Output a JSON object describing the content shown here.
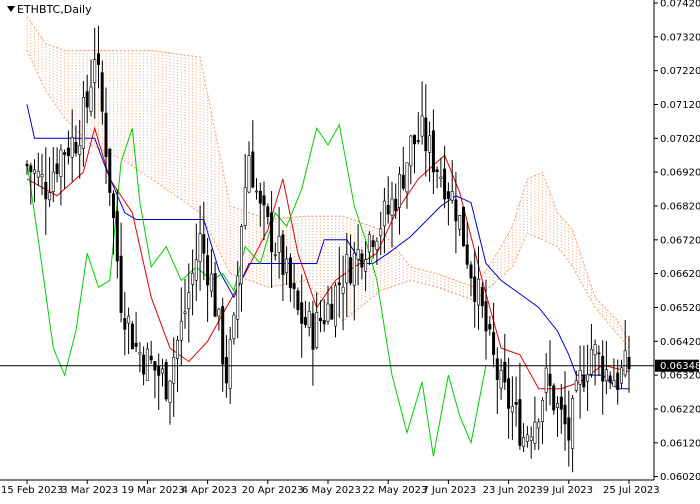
{
  "chart_data": {
    "type": "candlestick",
    "symbol": "ETHBTC",
    "timeframe": "Daily",
    "symbol_label": "ETHBTC,Daily",
    "current_price": 0.06348,
    "current_price_label": "0.06348",
    "ylim": [
      0.0601,
      0.0742
    ],
    "y_ticks": [
      0.0742,
      0.0732,
      0.0722,
      0.0712,
      0.0702,
      0.0692,
      0.0682,
      0.0672,
      0.0662,
      0.0652,
      0.0642,
      0.0632,
      0.0622,
      0.0612,
      0.0602
    ],
    "y_tick_labels": [
      "0.07420",
      "0.07320",
      "0.07220",
      "0.07120",
      "0.07020",
      "0.06920",
      "0.06820",
      "0.06720",
      "0.06620",
      "0.06520",
      "0.06420",
      "0.06320",
      "0.06220",
      "0.06120",
      "0.06020"
    ],
    "x_labels": [
      {
        "date": "2023-02-15",
        "label": "15 Feb 2023"
      },
      {
        "date": "2023-03-03",
        "label": "3 Mar 2023"
      },
      {
        "date": "2023-03-19",
        "label": "19 Mar 2023"
      },
      {
        "date": "2023-04-04",
        "label": "4 Apr 2023"
      },
      {
        "date": "2023-04-20",
        "label": "20 Apr 2023"
      },
      {
        "date": "2023-05-06",
        "label": "6 May 2023"
      },
      {
        "date": "2023-05-22",
        "label": "22 May 2023"
      },
      {
        "date": "2023-06-07",
        "label": "7 Jun 2023"
      },
      {
        "date": "2023-06-23",
        "label": "23 Jun 2023"
      },
      {
        "date": "2023-07-09",
        "label": "9 Jul 2023"
      },
      {
        "date": "2023-07-25",
        "label": "25 Jul 2023"
      }
    ],
    "date_range": [
      "2023-02-15",
      "2023-07-25"
    ],
    "close_anchors": [
      [
        "2023-02-15",
        0.0694
      ],
      [
        "2023-02-20",
        0.0688
      ],
      [
        "2023-02-24",
        0.0698
      ],
      [
        "2023-02-28",
        0.0702
      ],
      [
        "2023-03-03",
        0.0712
      ],
      [
        "2023-03-05",
        0.0728
      ],
      [
        "2023-03-08",
        0.07
      ],
      [
        "2023-03-12",
        0.0655
      ],
      [
        "2023-03-16",
        0.064
      ],
      [
        "2023-03-20",
        0.0635
      ],
      [
        "2023-03-24",
        0.063
      ],
      [
        "2023-03-28",
        0.0646
      ],
      [
        "2023-04-02",
        0.0672
      ],
      [
        "2023-04-05",
        0.066
      ],
      [
        "2023-04-09",
        0.0632
      ],
      [
        "2023-04-11",
        0.0645
      ],
      [
        "2023-04-13",
        0.0678
      ],
      [
        "2023-04-15",
        0.0698
      ],
      [
        "2023-04-18",
        0.068
      ],
      [
        "2023-04-23",
        0.0668
      ],
      [
        "2023-04-28",
        0.065
      ],
      [
        "2023-05-02",
        0.0645
      ],
      [
        "2023-05-06",
        0.0652
      ],
      [
        "2023-05-10",
        0.0662
      ],
      [
        "2023-05-14",
        0.0668
      ],
      [
        "2023-05-18",
        0.0675
      ],
      [
        "2023-05-22",
        0.068
      ],
      [
        "2023-05-25",
        0.0688
      ],
      [
        "2023-05-28",
        0.07
      ],
      [
        "2023-05-31",
        0.0703
      ],
      [
        "2023-06-03",
        0.0696
      ],
      [
        "2023-06-06",
        0.069
      ],
      [
        "2023-06-09",
        0.0682
      ],
      [
        "2023-06-12",
        0.0668
      ],
      [
        "2023-06-15",
        0.0655
      ],
      [
        "2023-06-18",
        0.064
      ],
      [
        "2023-06-21",
        0.0628
      ],
      [
        "2023-06-24",
        0.0622
      ],
      [
        "2023-06-27",
        0.0614
      ],
      [
        "2023-06-30",
        0.062
      ],
      [
        "2023-07-03",
        0.063
      ],
      [
        "2023-07-06",
        0.0622
      ],
      [
        "2023-07-09",
        0.0614
      ],
      [
        "2023-07-12",
        0.063
      ],
      [
        "2023-07-15",
        0.064
      ],
      [
        "2023-07-19",
        0.0633
      ],
      [
        "2023-07-22",
        0.0631
      ],
      [
        "2023-07-25",
        0.06348
      ]
    ],
    "series": [
      {
        "name": "tenkan",
        "color": "#e00000",
        "points": [
          [
            "2023-02-15",
            0.069
          ],
          [
            "2023-02-23",
            0.0685
          ],
          [
            "2023-03-02",
            0.0692
          ],
          [
            "2023-03-05",
            0.0705
          ],
          [
            "2023-03-09",
            0.069
          ],
          [
            "2023-03-15",
            0.068
          ],
          [
            "2023-03-20",
            0.0655
          ],
          [
            "2023-03-25",
            0.064
          ],
          [
            "2023-03-30",
            0.0636
          ],
          [
            "2023-04-04",
            0.0642
          ],
          [
            "2023-04-09",
            0.0652
          ],
          [
            "2023-04-14",
            0.0662
          ],
          [
            "2023-04-20",
            0.0675
          ],
          [
            "2023-04-24",
            0.069
          ],
          [
            "2023-04-28",
            0.0668
          ],
          [
            "2023-05-03",
            0.0652
          ],
          [
            "2023-05-08",
            0.066
          ],
          [
            "2023-05-13",
            0.0664
          ],
          [
            "2023-05-19",
            0.0668
          ],
          [
            "2023-05-24",
            0.068
          ],
          [
            "2023-05-30",
            0.069
          ],
          [
            "2023-06-06",
            0.0697
          ],
          [
            "2023-06-10",
            0.0686
          ],
          [
            "2023-06-16",
            0.066
          ],
          [
            "2023-06-21",
            0.064
          ],
          [
            "2023-06-26",
            0.0638
          ],
          [
            "2023-07-01",
            0.0628
          ],
          [
            "2023-07-07",
            0.0628
          ],
          [
            "2023-07-12",
            0.063
          ],
          [
            "2023-07-18",
            0.0635
          ],
          [
            "2023-07-25",
            0.0633
          ]
        ]
      },
      {
        "name": "kijun",
        "color": "#0000c8",
        "points": [
          [
            "2023-02-15",
            0.0712
          ],
          [
            "2023-02-17",
            0.0702
          ],
          [
            "2023-02-26",
            0.0702
          ],
          [
            "2023-03-05",
            0.0702
          ],
          [
            "2023-03-08",
            0.0693
          ],
          [
            "2023-03-13",
            0.068
          ],
          [
            "2023-03-16",
            0.0678
          ],
          [
            "2023-04-03",
            0.0678
          ],
          [
            "2023-04-07",
            0.0663
          ],
          [
            "2023-04-11",
            0.0655
          ],
          [
            "2023-04-15",
            0.0665
          ],
          [
            "2023-05-03",
            0.0665
          ],
          [
            "2023-05-05",
            0.0672
          ],
          [
            "2023-05-11",
            0.0672
          ],
          [
            "2023-05-15",
            0.0665
          ],
          [
            "2023-05-18",
            0.0665
          ],
          [
            "2023-05-22",
            0.0668
          ],
          [
            "2023-05-28",
            0.0673
          ],
          [
            "2023-06-05",
            0.0682
          ],
          [
            "2023-06-09",
            0.0685
          ],
          [
            "2023-06-13",
            0.0683
          ],
          [
            "2023-06-17",
            0.0665
          ],
          [
            "2023-06-21",
            0.066
          ],
          [
            "2023-06-26",
            0.0656
          ],
          [
            "2023-07-01",
            0.0652
          ],
          [
            "2023-07-06",
            0.0645
          ],
          [
            "2023-07-09",
            0.0638
          ],
          [
            "2023-07-11",
            0.0632
          ],
          [
            "2023-07-18",
            0.0632
          ],
          [
            "2023-07-22",
            0.0628
          ],
          [
            "2023-07-25",
            0.0628
          ]
        ]
      },
      {
        "name": "chikou",
        "color": "#00cc00",
        "points": [
          [
            "2023-02-15",
            0.0695
          ],
          [
            "2023-02-18",
            0.0672
          ],
          [
            "2023-02-22",
            0.064
          ],
          [
            "2023-02-25",
            0.0632
          ],
          [
            "2023-02-28",
            0.0645
          ],
          [
            "2023-03-03",
            0.0668
          ],
          [
            "2023-03-06",
            0.0658
          ],
          [
            "2023-03-09",
            0.066
          ],
          [
            "2023-03-12",
            0.0695
          ],
          [
            "2023-03-15",
            0.0705
          ],
          [
            "2023-03-17",
            0.0683
          ],
          [
            "2023-03-20",
            0.0664
          ],
          [
            "2023-03-24",
            0.067
          ],
          [
            "2023-03-28",
            0.066
          ],
          [
            "2023-04-01",
            0.0664
          ],
          [
            "2023-04-05",
            0.066
          ],
          [
            "2023-04-08",
            0.0662
          ],
          [
            "2023-04-11",
            0.0657
          ],
          [
            "2023-04-14",
            0.067
          ],
          [
            "2023-04-18",
            0.0665
          ],
          [
            "2023-04-22",
            0.068
          ],
          [
            "2023-04-25",
            0.0676
          ],
          [
            "2023-04-29",
            0.0687
          ],
          [
            "2023-05-03",
            0.0705
          ],
          [
            "2023-05-06",
            0.07
          ],
          [
            "2023-05-09",
            0.0706
          ],
          [
            "2023-05-13",
            0.0682
          ],
          [
            "2023-05-16",
            0.0672
          ],
          [
            "2023-05-19",
            0.066
          ],
          [
            "2023-05-23",
            0.0632
          ],
          [
            "2023-05-27",
            0.0615
          ],
          [
            "2023-05-31",
            0.063
          ],
          [
            "2023-06-03",
            0.0608
          ],
          [
            "2023-06-07",
            0.0632
          ],
          [
            "2023-06-10",
            0.062
          ],
          [
            "2023-06-13",
            0.0612
          ],
          [
            "2023-06-17",
            0.0635
          ]
        ]
      }
    ],
    "cloud": {
      "color": "#f0a07a",
      "span_a": [
        [
          "2023-02-15",
          0.0738
        ],
        [
          "2023-02-20",
          0.073
        ],
        [
          "2023-02-25",
          0.0728
        ],
        [
          "2023-03-04",
          0.0728
        ],
        [
          "2023-03-12",
          0.0728
        ],
        [
          "2023-03-20",
          0.0728
        ],
        [
          "2023-04-02",
          0.0726
        ],
        [
          "2023-04-10",
          0.0682
        ],
        [
          "2023-04-20",
          0.0678
        ],
        [
          "2023-04-30",
          0.0679
        ],
        [
          "2023-05-10",
          0.0679
        ],
        [
          "2023-05-20",
          0.0675
        ],
        [
          "2023-05-28",
          0.0664
        ],
        [
          "2023-06-04",
          0.0662
        ],
        [
          "2023-06-14",
          0.0658
        ],
        [
          "2023-06-20",
          0.0668
        ],
        [
          "2023-06-24",
          0.0676
        ],
        [
          "2023-06-28",
          0.069
        ],
        [
          "2023-07-02",
          0.0692
        ],
        [
          "2023-07-06",
          0.068
        ],
        [
          "2023-07-10",
          0.0675
        ],
        [
          "2023-07-16",
          0.0655
        ],
        [
          "2023-07-22",
          0.0648
        ],
        [
          "2023-07-25",
          0.0642
        ]
      ],
      "span_b": [
        [
          "2023-02-15",
          0.0728
        ],
        [
          "2023-02-20",
          0.0716
        ],
        [
          "2023-02-25",
          0.0708
        ],
        [
          "2023-03-04",
          0.07
        ],
        [
          "2023-03-12",
          0.0696
        ],
        [
          "2023-03-20",
          0.069
        ],
        [
          "2023-04-02",
          0.068
        ],
        [
          "2023-04-10",
          0.0662
        ],
        [
          "2023-04-20",
          0.0658
        ],
        [
          "2023-04-30",
          0.066
        ],
        [
          "2023-05-10",
          0.0648
        ],
        [
          "2023-05-20",
          0.0657
        ],
        [
          "2023-05-28",
          0.066
        ],
        [
          "2023-06-04",
          0.0658
        ],
        [
          "2023-06-14",
          0.0654
        ],
        [
          "2023-06-20",
          0.066
        ],
        [
          "2023-06-24",
          0.0664
        ],
        [
          "2023-06-28",
          0.0674
        ],
        [
          "2023-07-02",
          0.0672
        ],
        [
          "2023-07-06",
          0.067
        ],
        [
          "2023-07-10",
          0.0664
        ],
        [
          "2023-07-16",
          0.0652
        ],
        [
          "2023-07-22",
          0.0644
        ],
        [
          "2023-07-25",
          0.064
        ]
      ]
    },
    "grid": false,
    "legend": "none"
  }
}
